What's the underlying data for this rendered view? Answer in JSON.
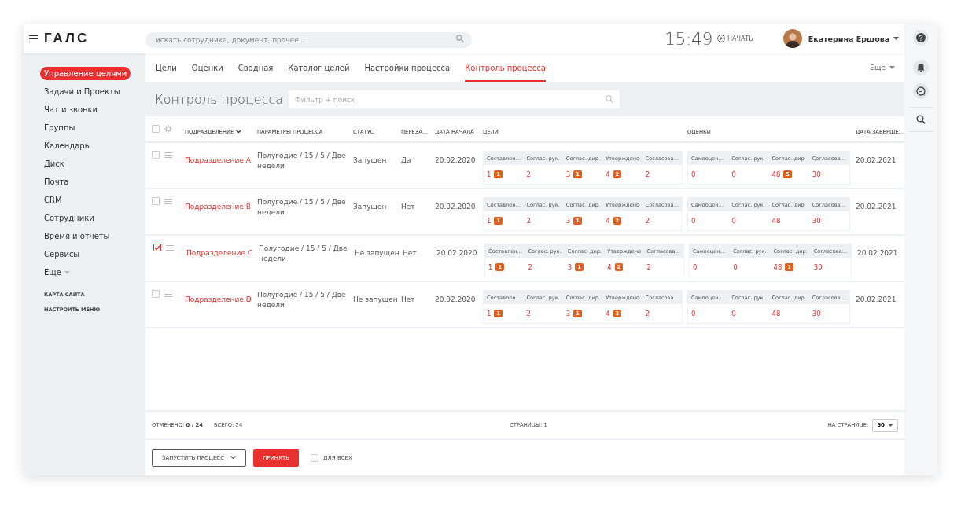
{
  "app": {
    "logo": "ГАЛС",
    "search_placeholder": "искать сотрудника, документ, прочее...",
    "clock": "15:49",
    "start_label": "НАЧАТЬ",
    "user_name": "Екатерина Ершова"
  },
  "sidebar": {
    "items": [
      {
        "label": "Управление целями",
        "selected": true
      },
      {
        "label": "Задачи и Проекты",
        "selected": false
      },
      {
        "label": "Чат и звонки",
        "selected": false
      },
      {
        "label": "Группы",
        "selected": false
      },
      {
        "label": "Календарь",
        "selected": false
      },
      {
        "label": "Диск",
        "selected": false
      },
      {
        "label": "Почта",
        "selected": false
      },
      {
        "label": "CRM",
        "selected": false
      },
      {
        "label": "Сотрудники",
        "selected": false
      },
      {
        "label": "Время и отчеты",
        "selected": false
      },
      {
        "label": "Сервисы",
        "selected": false
      }
    ],
    "more": "Еще",
    "links": [
      "КАРТА САЙТА",
      "НАСТРОИТЬ МЕНЮ"
    ]
  },
  "tabs": [
    {
      "label": "Цели",
      "selected": false
    },
    {
      "label": "Оценки",
      "selected": false
    },
    {
      "label": "Сводная",
      "selected": false
    },
    {
      "label": "Каталог целей",
      "selected": false
    },
    {
      "label": "Настройки процесса",
      "selected": false
    },
    {
      "label": "Контроль процесса",
      "selected": true
    }
  ],
  "tabs_more": "Еще",
  "page": {
    "title": "Контроль процесса",
    "filter_placeholder": "Фильтр + поиск"
  },
  "table": {
    "all_checked": false,
    "columns": [
      {
        "label": "ПОДРАЗДЕЛЕНИЕ",
        "sorted": true
      },
      {
        "label": "ПАРАМЕТРЫ ПРОЦЕССА",
        "sorted": false
      },
      {
        "label": "СТАТУС",
        "sorted": false
      },
      {
        "label": "ПЕРЕЗА…",
        "sorted": false
      },
      {
        "label": "ДАТА НАЧАЛА",
        "sorted": false
      },
      {
        "label": "ЦЕЛИ",
        "sorted": false
      },
      {
        "label": "ОЦЕНКИ",
        "sorted": false
      },
      {
        "label": "ДАТА ЗАВЕРШЕ…",
        "sorted": false
      }
    ],
    "rows": [
      {
        "checked": false,
        "name": "Подразделение A",
        "params": "Полугодие / 15 / 5 / Две недели",
        "status": "Запущен",
        "reassign": "Да",
        "start": "20.02.2020",
        "goals": [
          {
            "label": "Составлен…",
            "value": "1",
            "badge": "1"
          },
          {
            "label": "Соглас. рук.",
            "value": "2"
          },
          {
            "label": "Соглас. дир.",
            "value": "3",
            "badge": "1"
          },
          {
            "label": "Утверждено",
            "value": "4",
            "badge": "2"
          },
          {
            "label": "Согласова…",
            "value": "2"
          }
        ],
        "ratings": [
          {
            "label": "Самооцен…",
            "value": "0"
          },
          {
            "label": "Соглас. рук.",
            "value": "0"
          },
          {
            "label": "Соглас. дир.",
            "value": "48",
            "badge": "5"
          },
          {
            "label": "Согласова…",
            "value": "30"
          }
        ],
        "end": "20.02.2021"
      },
      {
        "checked": false,
        "name": "Подразделение B",
        "params": "Полугодие / 15 / 5 / Две недели",
        "status": "Запущен",
        "reassign": "Нет",
        "start": "20.02.2020",
        "goals": [
          {
            "label": "Составлен…",
            "value": "1",
            "badge": "1"
          },
          {
            "label": "Соглас. рук.",
            "value": "2"
          },
          {
            "label": "Соглас. дир.",
            "value": "3",
            "badge": "1"
          },
          {
            "label": "Утверждено",
            "value": "4",
            "badge": "2"
          },
          {
            "label": "Согласова…",
            "value": "2"
          }
        ],
        "ratings": [
          {
            "label": "Самооцен…",
            "value": "0"
          },
          {
            "label": "Соглас. рук.",
            "value": "0"
          },
          {
            "label": "Соглас. дир.",
            "value": "48"
          },
          {
            "label": "Согласова…",
            "value": "30"
          }
        ],
        "end": "20.02.2021"
      },
      {
        "checked": true,
        "name": "Подразделение C",
        "params": "Полугодие / 15 / 5 / Две недели",
        "status": "Не запущен",
        "reassign": "Нет",
        "start": "20.02.2020",
        "goals": [
          {
            "label": "Составлен…",
            "value": "1",
            "badge": "1"
          },
          {
            "label": "Соглас. рук.",
            "value": "2"
          },
          {
            "label": "Соглас. дир.",
            "value": "3",
            "badge": "1"
          },
          {
            "label": "Утверждено",
            "value": "4",
            "badge": "2"
          },
          {
            "label": "Согласова…",
            "value": "2"
          }
        ],
        "ratings": [
          {
            "label": "Самооцен…",
            "value": "0"
          },
          {
            "label": "Соглас. рук.",
            "value": "0"
          },
          {
            "label": "Соглас. дир.",
            "value": "48",
            "badge": "1"
          },
          {
            "label": "Согласова…",
            "value": "30"
          }
        ],
        "end": "20.02.2021"
      },
      {
        "checked": false,
        "name": "Подразделение D",
        "params": "Полугодие / 15 / 5 / Две недели",
        "status": "Не запущен",
        "reassign": "Нет",
        "start": "20.02.2020",
        "goals": [
          {
            "label": "Составлен…",
            "value": "1",
            "badge": "1"
          },
          {
            "label": "Соглас. рук.",
            "value": "2"
          },
          {
            "label": "Соглас. дир.",
            "value": "3",
            "badge": "1"
          },
          {
            "label": "Утверждено",
            "value": "4",
            "badge": "2"
          },
          {
            "label": "Согласова…",
            "value": "2"
          }
        ],
        "ratings": [
          {
            "label": "Самооцен…",
            "value": "0"
          },
          {
            "label": "Соглас. рук.",
            "value": "0"
          },
          {
            "label": "Соглас. дир.",
            "value": "48"
          },
          {
            "label": "Согласова…",
            "value": "30"
          }
        ],
        "end": "20.02.2021"
      }
    ]
  },
  "footer": {
    "marked": "ОТМЕЧЕНО: **0 / 24**",
    "total": "ВСЕГО: 24",
    "pages": "СТРАНИЦЫ: 1",
    "per_page_label": "НА СТРАНИЦЕ:",
    "per_page": "50"
  },
  "actions": {
    "start_button": "ЗАПУСТИТЬ ПРОЦЕСС",
    "accept_button": "ПРИНЯТЬ",
    "for_all": {
      "label": "ДЛЯ ВСЕХ",
      "checked": false
    }
  }
}
